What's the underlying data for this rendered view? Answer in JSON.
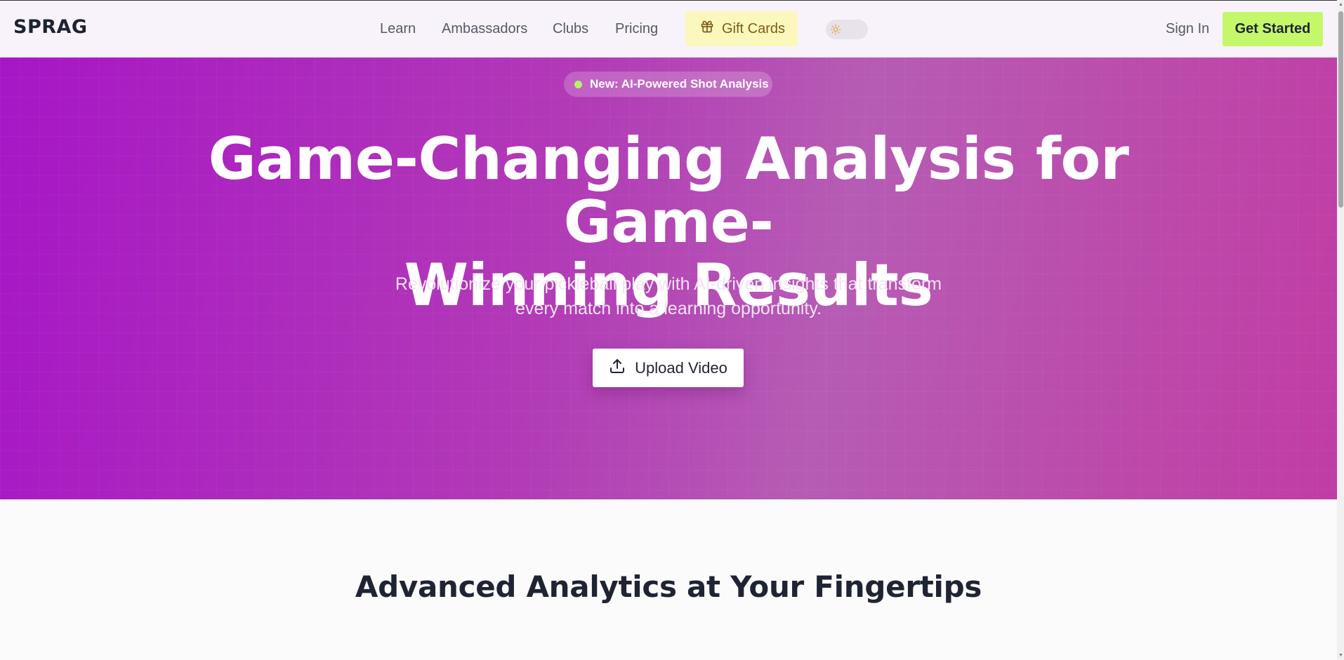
{
  "header": {
    "logo": "SPRAG",
    "nav": [
      "Learn",
      "Ambassadors",
      "Clubs",
      "Pricing"
    ],
    "gift_cards": "Gift Cards",
    "sign_in": "Sign In",
    "get_started": "Get Started"
  },
  "hero": {
    "badge": "New: AI-Powered Shot Analysis",
    "title_line1": "Game-Changing Analysis for Game-",
    "title_line2": "Winning Results",
    "subtitle_line1": "Revolutionize your pickleball play with AI-driven insights that transform",
    "subtitle_line2": "every match into a learning opportunity.",
    "upload_button": "Upload Video"
  },
  "features": {
    "title": "Advanced Analytics at Your Fingertips"
  },
  "icons": {
    "gift": "gift-icon",
    "theme": "sun-icon",
    "upload": "upload-icon"
  },
  "colors": {
    "accent_green": "#c5f76b",
    "gift_bg": "#fcf7bd",
    "hero_purple": "#a716c6",
    "hero_pink": "#c13ca5"
  }
}
